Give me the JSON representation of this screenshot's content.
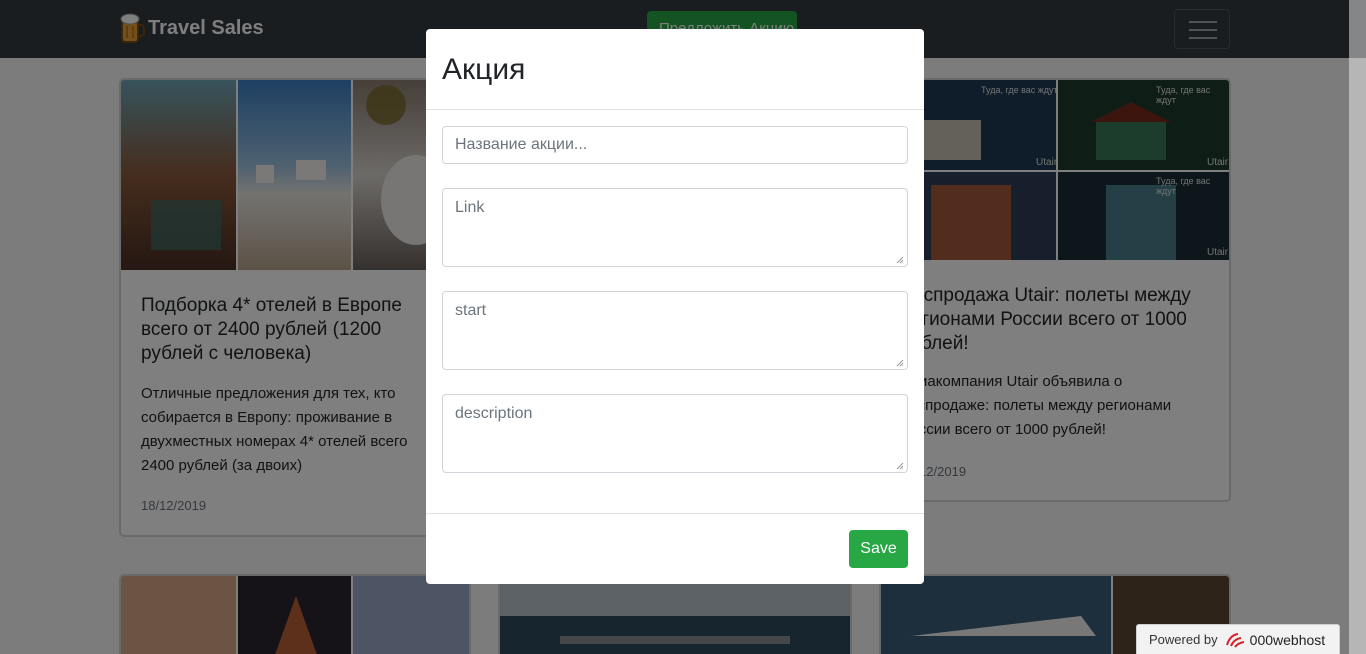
{
  "navbar": {
    "brand": "Travel Sales",
    "add_button_label": "Предложить Акцию"
  },
  "cards": [
    {
      "title": "Подборка 4* отелей в Европе всего от 2400 рублей (1200 рублей с человека)",
      "text": "Отличные предложения для тех, кто собирается в Европу: проживание в двухместных номерах 4* отелей всего 2400 рублей (за двоих)",
      "date": "18/12/2019"
    },
    {
      "title": "Распродажа Utair: полеты между регионами России всего от 1000 рублей!",
      "text": "Авиакомпания Utair объявила о распродаже: полеты между регионами России всего от 1000 рублей!",
      "date": "18/12/2019",
      "image_captions": [
        "Туда, где вас ждут",
        "Туда, где вас ждут",
        "Туда, где вас ждут"
      ],
      "image_logo": "Utair"
    }
  ],
  "modal": {
    "title": "Акция",
    "name_placeholder": "Название акции...",
    "link_placeholder": "Link",
    "start_placeholder": "start",
    "description_placeholder": "description",
    "save_label": "Save"
  },
  "footer": {
    "powered_by": "Powered by",
    "host": "000webhost"
  },
  "colors": {
    "navbar": "#343a40",
    "success": "#28a745"
  }
}
